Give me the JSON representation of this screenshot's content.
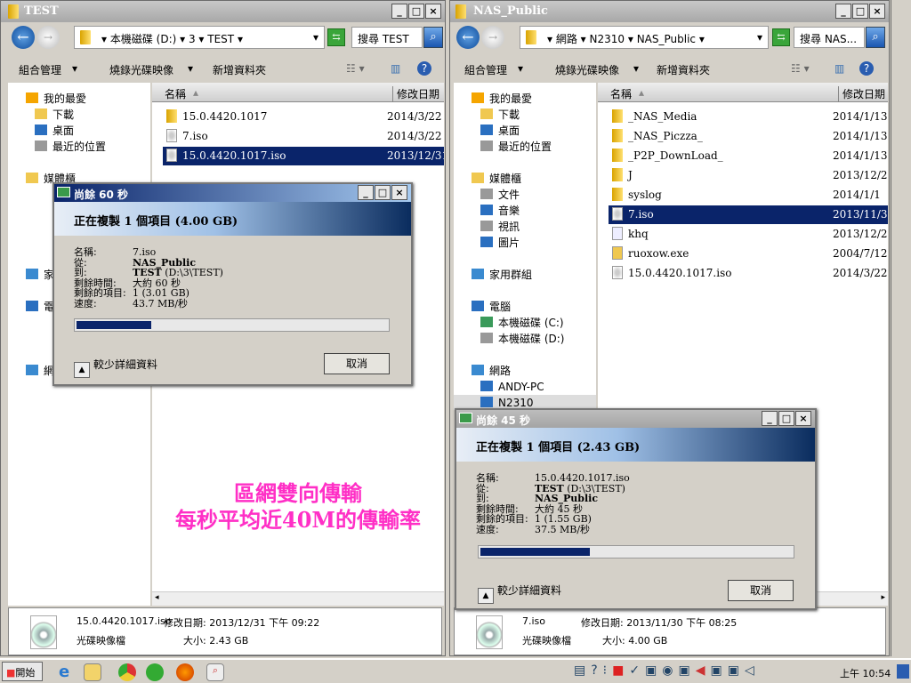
{
  "left_window": {
    "title": "TEST",
    "breadcrumb": [
      "本機磁碟 (D:)",
      "3",
      "TEST"
    ],
    "search_placeholder": "搜尋 TEST",
    "toolbar": {
      "organize": "組合管理",
      "burn": "燒錄光碟映像",
      "new_folder": "新增資料夾"
    },
    "nav": [
      "我的最愛",
      "下載",
      "桌面",
      "最近的位置",
      "媒體櫃",
      "家",
      "電",
      "網"
    ],
    "columns": {
      "name": "名稱",
      "date": "修改日期"
    },
    "files": [
      {
        "name": "15.0.4420.1017",
        "date": "2014/3/22",
        "type": "folder"
      },
      {
        "name": "7.iso",
        "date": "2014/3/22",
        "type": "iso"
      },
      {
        "name": "15.0.4420.1017.iso",
        "date": "2013/12/31",
        "type": "iso",
        "selected": true
      }
    ],
    "details": {
      "name": "15.0.4420.1017.iso",
      "modified": "修改日期: 2013/12/31 下午 09:22",
      "type": "光碟映像檔",
      "size": "大小: 2.43 GB"
    }
  },
  "left_dialog": {
    "title": "尚餘 60 秒",
    "heading": "正在複製 1 個項目 (4.00 GB)",
    "rows": [
      {
        "k": "名稱:",
        "v": "7.iso",
        "b": ""
      },
      {
        "k": "從:",
        "v": "",
        "b": "NAS_Public"
      },
      {
        "k": "到:",
        "v": " (D:\\3\\TEST)",
        "b": "TEST"
      },
      {
        "k": "剩餘時間:",
        "v": "大約 60 秒",
        "b": ""
      },
      {
        "k": "剩餘的項目:",
        "v": "1 (3.01 GB)",
        "b": ""
      },
      {
        "k": "速度:",
        "v": "43.7 MB/秒",
        "b": ""
      }
    ],
    "progress_percent": 25,
    "fewer_details": "較少詳細資料",
    "cancel": "取消"
  },
  "right_window": {
    "title": "NAS_Public",
    "breadcrumb": [
      "網路",
      "N2310",
      "NAS_Public"
    ],
    "search_placeholder": "搜尋 NAS...",
    "toolbar": {
      "organize": "組合管理",
      "burn": "燒錄光碟映像",
      "new_folder": "新增資料夾"
    },
    "nav": [
      "我的最愛",
      "下載",
      "桌面",
      "最近的位置",
      "媒體櫃",
      "文件",
      "音樂",
      "視訊",
      "圖片",
      "家用群組",
      "電腦",
      "本機磁碟 (C:)",
      "本機磁碟 (D:)",
      "網路",
      "ANDY-PC",
      "N2310"
    ],
    "columns": {
      "name": "名稱",
      "date": "修改日期"
    },
    "files": [
      {
        "name": "_NAS_Media",
        "date": "2014/1/13",
        "type": "folder"
      },
      {
        "name": "_NAS_Piczza_",
        "date": "2014/1/13",
        "type": "folder"
      },
      {
        "name": "_P2P_DownLoad_",
        "date": "2014/1/13",
        "type": "folder"
      },
      {
        "name": "J",
        "date": "2013/12/2",
        "type": "folder"
      },
      {
        "name": "syslog",
        "date": "2014/1/1",
        "type": "folder"
      },
      {
        "name": "7.iso",
        "date": "2013/11/3",
        "type": "iso",
        "selected": true
      },
      {
        "name": "khq",
        "date": "2013/12/2",
        "type": "file"
      },
      {
        "name": "ruoxow.exe",
        "date": "2004/7/12",
        "type": "folder-open"
      },
      {
        "name": "15.0.4420.1017.iso",
        "date": "2014/3/22",
        "type": "iso"
      }
    ],
    "details": {
      "name": "7.iso",
      "modified": "修改日期: 2013/11/30 下午 08:25",
      "type": "光碟映像檔",
      "size": "大小: 4.00 GB"
    }
  },
  "right_dialog": {
    "title": "尚餘 45 秒",
    "heading": "正在複製 1 個項目 (2.43 GB)",
    "rows": [
      {
        "k": "名稱:",
        "v": "15.0.4420.1017.iso",
        "b": ""
      },
      {
        "k": "從:",
        "v": " (D:\\3\\TEST)",
        "b": "TEST"
      },
      {
        "k": "到:",
        "v": "",
        "b": "NAS_Public"
      },
      {
        "k": "剩餘時間:",
        "v": "大約 45 秒",
        "b": ""
      },
      {
        "k": "剩餘的項目:",
        "v": "1 (1.55 GB)",
        "b": ""
      },
      {
        "k": "速度:",
        "v": "37.5 MB/秒",
        "b": ""
      }
    ],
    "progress_percent": 36,
    "fewer_details": "較少詳細資料",
    "cancel": "取消"
  },
  "overlay": {
    "line1": "區網雙向傳輸",
    "line2": "每秒平均近40M的傳輸率"
  },
  "taskbar": {
    "start": "開始",
    "clock": "上午 10:54"
  },
  "colors": {
    "selection": "#0a246a",
    "overlay_text": "#ff2fc6",
    "progress": "#0a246a"
  }
}
